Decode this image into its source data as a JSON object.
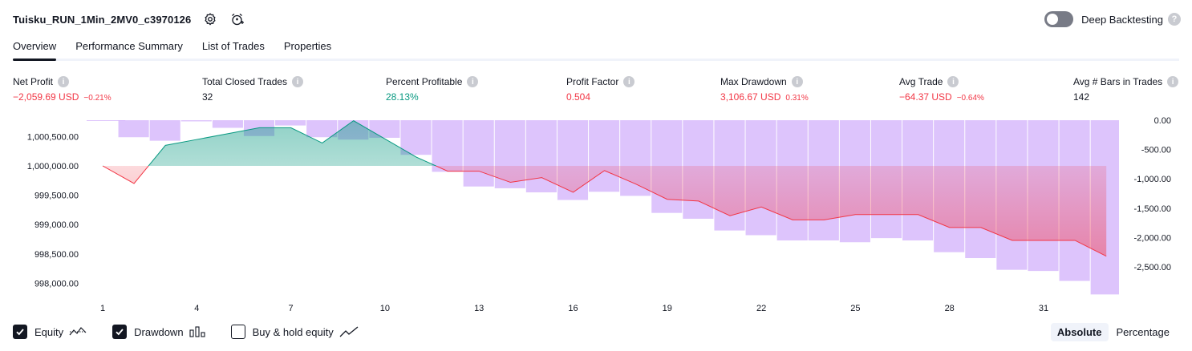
{
  "header": {
    "strategy_name": "Tuisku_RUN_1Min_2MV0_c3970126",
    "settings_icon": "gear-icon",
    "alert_icon": "alarm-clock-plus-icon"
  },
  "deep_backtesting": {
    "label": "Deep Backtesting",
    "enabled": false,
    "help": "?"
  },
  "tabs": [
    {
      "label": "Overview",
      "active": true
    },
    {
      "label": "Performance Summary",
      "active": false
    },
    {
      "label": "List of Trades",
      "active": false
    },
    {
      "label": "Properties",
      "active": false
    }
  ],
  "metrics": [
    {
      "label": "Net Profit",
      "value": "−2,059.69 USD",
      "sub": "−0.21%",
      "tone": "neg"
    },
    {
      "label": "Total Closed Trades",
      "value": "32",
      "sub": "",
      "tone": "neutral"
    },
    {
      "label": "Percent Profitable",
      "value": "28.13%",
      "sub": "",
      "tone": "pos"
    },
    {
      "label": "Profit Factor",
      "value": "0.504",
      "sub": "",
      "tone": "neg"
    },
    {
      "label": "Max Drawdown",
      "value": "3,106.67 USD",
      "sub": "0.31%",
      "tone": "neg"
    },
    {
      "label": "Avg Trade",
      "value": "−64.37 USD",
      "sub": "−0.64%",
      "tone": "neg"
    },
    {
      "label": "Avg # Bars in Trades",
      "value": "142",
      "sub": "",
      "tone": "neutral"
    }
  ],
  "chart_data": {
    "type": "line",
    "x_ticks": [
      "1",
      "4",
      "7",
      "10",
      "13",
      "16",
      "19",
      "22",
      "25",
      "28",
      "31"
    ],
    "left_axis": {
      "ticks": [
        "1,000,500.00",
        "1,000,000.00",
        "999,500.00",
        "999,000.00",
        "998,500.00",
        "998,000.00"
      ],
      "tick_values": [
        1000500,
        1000000,
        999500,
        999000,
        998500,
        998000
      ],
      "baseline": 1000000
    },
    "right_axis": {
      "ticks": [
        "0.00",
        "-500.00",
        "-1,000.00",
        "-1,500.00",
        "-2,000.00",
        "-2,500.00"
      ],
      "tick_values": [
        0,
        -500,
        -1000,
        -1500,
        -2000,
        -2500
      ]
    },
    "x": [
      1,
      2,
      3,
      4,
      5,
      6,
      7,
      8,
      9,
      10,
      11,
      12,
      13,
      14,
      15,
      16,
      17,
      18,
      19,
      20,
      21,
      22,
      23,
      24,
      25,
      26,
      27,
      28,
      29,
      30,
      31,
      32,
      33
    ],
    "series": [
      {
        "name": "Equity",
        "values": [
          1000000,
          999700,
          1000350,
          1000450,
          1000550,
          1000650,
          1000650,
          1000390,
          1000770,
          1000460,
          1000150,
          999910,
          999910,
          999720,
          999800,
          999550,
          999920,
          999690,
          999430,
          999400,
          999150,
          999300,
          999080,
          999080,
          999170,
          999170,
          999170,
          998950,
          998950,
          998730,
          998730,
          998730,
          998460
        ]
      },
      {
        "name": "Drawdown",
        "values": [
          -10,
          -290,
          -350,
          -20,
          -130,
          -270,
          -90,
          -290,
          -330,
          -300,
          -590,
          -880,
          -1130,
          -1160,
          -1230,
          -1360,
          -1220,
          -1290,
          -1580,
          -1680,
          -1880,
          -1960,
          -2050,
          -2050,
          -2080,
          -2010,
          -2050,
          -2250,
          -2350,
          -2550,
          -2570,
          -2740,
          -2970
        ]
      }
    ],
    "legend": [
      {
        "label": "Equity",
        "checked": true,
        "icon": "equity-line-icon"
      },
      {
        "label": "Drawdown",
        "checked": true,
        "icon": "drawdown-bars-icon"
      },
      {
        "label": "Buy & hold equity",
        "checked": false,
        "icon": "buy-hold-line-icon"
      }
    ],
    "colors": {
      "profit_line": "#089981",
      "loss_line": "#f23645",
      "drawdown_fill": "#d1b0fb",
      "profit_fill": "#b2dfdb",
      "loss_fill": "#f7a1b0"
    }
  },
  "display_mode": {
    "options": [
      "Absolute",
      "Percentage"
    ],
    "selected": "Absolute"
  }
}
